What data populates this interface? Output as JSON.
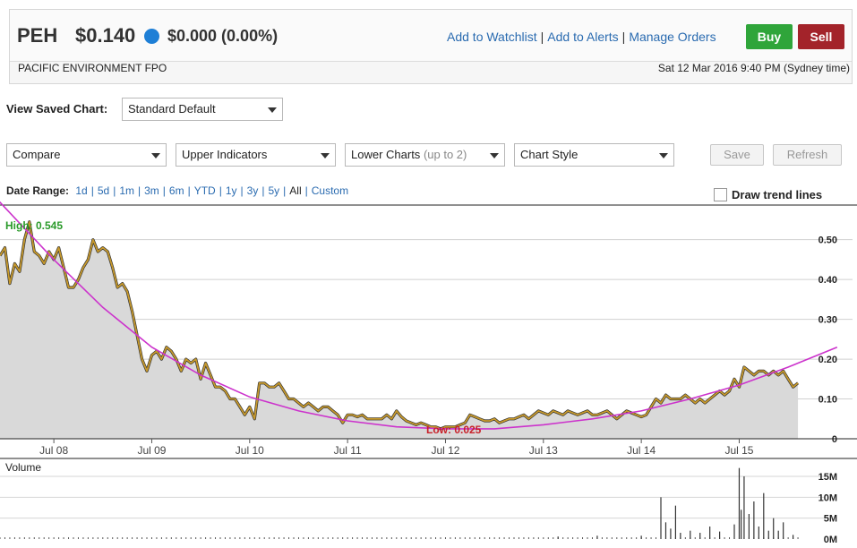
{
  "quote": {
    "ticker": "PEH",
    "price": "$0.140",
    "change": "$0.000 (0.00%)",
    "company": "PACIFIC ENVIRONMENT FPO",
    "datetime": "Sat 12 Mar 2016 9:40 PM (Sydney time)",
    "status_color": "#1e7fd6"
  },
  "actions": {
    "watchlist": "Add to Watchlist",
    "alerts": "Add to Alerts",
    "orders": "Manage Orders",
    "buy": "Buy",
    "sell": "Sell"
  },
  "controls": {
    "saved_label": "View Saved Chart:",
    "saved_value": "Standard Default",
    "compare": "Compare",
    "upper": "Upper Indicators",
    "lower": "Lower Charts",
    "lower_note": "(up to 2)",
    "style": "Chart Style",
    "save": "Save",
    "refresh": "Refresh",
    "date_range_label": "Date Range:",
    "ranges": [
      "1d",
      "5d",
      "1m",
      "3m",
      "6m",
      "YTD",
      "1y",
      "3y",
      "5y",
      "All",
      "Custom"
    ],
    "selected_range": "All",
    "trend_label": "Draw trend lines"
  },
  "chart_data": {
    "type": "line",
    "x_ticks": [
      "Jul 08",
      "Jul 09",
      "Jul 10",
      "Jul 11",
      "Jul 12",
      "Jul 13",
      "Jul 14",
      "Jul 15"
    ],
    "x_tick_dates": [
      2008.5,
      2009.5,
      2010.5,
      2011.5,
      2012.5,
      2013.5,
      2014.5,
      2015.5
    ],
    "x_range": [
      2007.95,
      2016.2
    ],
    "ylim": [
      0,
      0.56
    ],
    "y_ticks": [
      0,
      0.1,
      0.2,
      0.3,
      0.4,
      0.5
    ],
    "y_tick_labels": [
      "0",
      "0.10",
      "0.20",
      "0.30",
      "0.40",
      "0.50"
    ],
    "high_label": "High: 0.545",
    "low_label": "Low: 0.025",
    "price_series": [
      [
        2007.95,
        0.46
      ],
      [
        2008.0,
        0.48
      ],
      [
        2008.05,
        0.39
      ],
      [
        2008.1,
        0.44
      ],
      [
        2008.15,
        0.42
      ],
      [
        2008.2,
        0.5
      ],
      [
        2008.25,
        0.545
      ],
      [
        2008.3,
        0.47
      ],
      [
        2008.35,
        0.46
      ],
      [
        2008.4,
        0.44
      ],
      [
        2008.45,
        0.47
      ],
      [
        2008.5,
        0.45
      ],
      [
        2008.55,
        0.48
      ],
      [
        2008.6,
        0.43
      ],
      [
        2008.65,
        0.38
      ],
      [
        2008.7,
        0.38
      ],
      [
        2008.75,
        0.4
      ],
      [
        2008.8,
        0.43
      ],
      [
        2008.85,
        0.45
      ],
      [
        2008.9,
        0.5
      ],
      [
        2008.95,
        0.47
      ],
      [
        2009.0,
        0.48
      ],
      [
        2009.05,
        0.47
      ],
      [
        2009.1,
        0.43
      ],
      [
        2009.15,
        0.38
      ],
      [
        2009.2,
        0.39
      ],
      [
        2009.25,
        0.37
      ],
      [
        2009.3,
        0.32
      ],
      [
        2009.35,
        0.26
      ],
      [
        2009.4,
        0.2
      ],
      [
        2009.45,
        0.17
      ],
      [
        2009.5,
        0.21
      ],
      [
        2009.55,
        0.22
      ],
      [
        2009.6,
        0.2
      ],
      [
        2009.65,
        0.23
      ],
      [
        2009.7,
        0.22
      ],
      [
        2009.75,
        0.2
      ],
      [
        2009.8,
        0.17
      ],
      [
        2009.85,
        0.2
      ],
      [
        2009.9,
        0.19
      ],
      [
        2009.95,
        0.2
      ],
      [
        2010.0,
        0.15
      ],
      [
        2010.05,
        0.19
      ],
      [
        2010.1,
        0.16
      ],
      [
        2010.15,
        0.13
      ],
      [
        2010.2,
        0.13
      ],
      [
        2010.25,
        0.12
      ],
      [
        2010.3,
        0.1
      ],
      [
        2010.35,
        0.1
      ],
      [
        2010.4,
        0.08
      ],
      [
        2010.45,
        0.06
      ],
      [
        2010.5,
        0.08
      ],
      [
        2010.55,
        0.05
      ],
      [
        2010.6,
        0.14
      ],
      [
        2010.65,
        0.14
      ],
      [
        2010.7,
        0.13
      ],
      [
        2010.75,
        0.13
      ],
      [
        2010.8,
        0.14
      ],
      [
        2010.85,
        0.12
      ],
      [
        2010.9,
        0.1
      ],
      [
        2010.95,
        0.1
      ],
      [
        2011.0,
        0.09
      ],
      [
        2011.05,
        0.08
      ],
      [
        2011.1,
        0.09
      ],
      [
        2011.15,
        0.08
      ],
      [
        2011.2,
        0.07
      ],
      [
        2011.25,
        0.08
      ],
      [
        2011.3,
        0.08
      ],
      [
        2011.35,
        0.07
      ],
      [
        2011.4,
        0.06
      ],
      [
        2011.45,
        0.04
      ],
      [
        2011.5,
        0.06
      ],
      [
        2011.55,
        0.06
      ],
      [
        2011.6,
        0.055
      ],
      [
        2011.65,
        0.06
      ],
      [
        2011.7,
        0.05
      ],
      [
        2011.75,
        0.05
      ],
      [
        2011.8,
        0.05
      ],
      [
        2011.85,
        0.05
      ],
      [
        2011.9,
        0.06
      ],
      [
        2011.95,
        0.05
      ],
      [
        2012.0,
        0.07
      ],
      [
        2012.05,
        0.055
      ],
      [
        2012.1,
        0.045
      ],
      [
        2012.15,
        0.04
      ],
      [
        2012.2,
        0.035
      ],
      [
        2012.25,
        0.04
      ],
      [
        2012.3,
        0.035
      ],
      [
        2012.35,
        0.03
      ],
      [
        2012.4,
        0.03
      ],
      [
        2012.45,
        0.025
      ],
      [
        2012.5,
        0.03
      ],
      [
        2012.55,
        0.03
      ],
      [
        2012.6,
        0.03
      ],
      [
        2012.65,
        0.035
      ],
      [
        2012.7,
        0.04
      ],
      [
        2012.75,
        0.06
      ],
      [
        2012.8,
        0.055
      ],
      [
        2012.85,
        0.05
      ],
      [
        2012.9,
        0.045
      ],
      [
        2012.95,
        0.045
      ],
      [
        2013.0,
        0.05
      ],
      [
        2013.05,
        0.04
      ],
      [
        2013.1,
        0.045
      ],
      [
        2013.15,
        0.05
      ],
      [
        2013.2,
        0.05
      ],
      [
        2013.25,
        0.055
      ],
      [
        2013.3,
        0.06
      ],
      [
        2013.35,
        0.05
      ],
      [
        2013.4,
        0.06
      ],
      [
        2013.45,
        0.07
      ],
      [
        2013.5,
        0.065
      ],
      [
        2013.55,
        0.06
      ],
      [
        2013.6,
        0.07
      ],
      [
        2013.65,
        0.065
      ],
      [
        2013.7,
        0.06
      ],
      [
        2013.75,
        0.07
      ],
      [
        2013.8,
        0.065
      ],
      [
        2013.85,
        0.06
      ],
      [
        2013.9,
        0.065
      ],
      [
        2013.95,
        0.07
      ],
      [
        2014.0,
        0.06
      ],
      [
        2014.05,
        0.06
      ],
      [
        2014.1,
        0.065
      ],
      [
        2014.15,
        0.07
      ],
      [
        2014.2,
        0.06
      ],
      [
        2014.25,
        0.05
      ],
      [
        2014.3,
        0.06
      ],
      [
        2014.35,
        0.07
      ],
      [
        2014.4,
        0.065
      ],
      [
        2014.45,
        0.06
      ],
      [
        2014.5,
        0.055
      ],
      [
        2014.55,
        0.06
      ],
      [
        2014.6,
        0.08
      ],
      [
        2014.65,
        0.1
      ],
      [
        2014.7,
        0.09
      ],
      [
        2014.75,
        0.11
      ],
      [
        2014.8,
        0.1
      ],
      [
        2014.85,
        0.1
      ],
      [
        2014.9,
        0.1
      ],
      [
        2014.95,
        0.11
      ],
      [
        2015.0,
        0.1
      ],
      [
        2015.05,
        0.09
      ],
      [
        2015.1,
        0.1
      ],
      [
        2015.15,
        0.09
      ],
      [
        2015.2,
        0.1
      ],
      [
        2015.25,
        0.11
      ],
      [
        2015.3,
        0.12
      ],
      [
        2015.35,
        0.11
      ],
      [
        2015.4,
        0.12
      ],
      [
        2015.45,
        0.15
      ],
      [
        2015.5,
        0.13
      ],
      [
        2015.55,
        0.18
      ],
      [
        2015.6,
        0.17
      ],
      [
        2015.65,
        0.16
      ],
      [
        2015.7,
        0.17
      ],
      [
        2015.75,
        0.17
      ],
      [
        2015.8,
        0.16
      ],
      [
        2015.85,
        0.17
      ],
      [
        2015.9,
        0.16
      ],
      [
        2015.95,
        0.17
      ],
      [
        2016.0,
        0.15
      ],
      [
        2016.05,
        0.13
      ],
      [
        2016.1,
        0.14
      ]
    ],
    "trend_curve": [
      [
        2007.85,
        0.62
      ],
      [
        2008.5,
        0.45
      ],
      [
        2009.0,
        0.33
      ],
      [
        2009.5,
        0.23
      ],
      [
        2010.0,
        0.16
      ],
      [
        2010.5,
        0.105
      ],
      [
        2011.0,
        0.07
      ],
      [
        2011.5,
        0.045
      ],
      [
        2012.0,
        0.03
      ],
      [
        2012.5,
        0.025
      ],
      [
        2013.0,
        0.025
      ],
      [
        2013.5,
        0.035
      ],
      [
        2014.0,
        0.05
      ],
      [
        2014.5,
        0.07
      ],
      [
        2015.0,
        0.1
      ],
      [
        2015.5,
        0.135
      ],
      [
        2016.0,
        0.18
      ],
      [
        2016.5,
        0.23
      ]
    ],
    "volume_label": "Volume",
    "volume_ylim": [
      0,
      18
    ],
    "volume_ticks": [
      0,
      5,
      10,
      15
    ],
    "volume_tick_labels": [
      "0M",
      "5M",
      "10M",
      "15M"
    ],
    "volume_spikes": [
      [
        2013.65,
        0.6
      ],
      [
        2014.05,
        0.8
      ],
      [
        2014.5,
        0.8
      ],
      [
        2014.7,
        10
      ],
      [
        2014.75,
        4
      ],
      [
        2014.8,
        2.5
      ],
      [
        2014.85,
        8
      ],
      [
        2014.9,
        1.5
      ],
      [
        2015.0,
        2
      ],
      [
        2015.1,
        1.5
      ],
      [
        2015.2,
        3
      ],
      [
        2015.3,
        1.8
      ],
      [
        2015.45,
        3.5
      ],
      [
        2015.5,
        17
      ],
      [
        2015.52,
        7
      ],
      [
        2015.55,
        15
      ],
      [
        2015.6,
        6
      ],
      [
        2015.65,
        9
      ],
      [
        2015.7,
        3
      ],
      [
        2015.75,
        11
      ],
      [
        2015.8,
        2
      ],
      [
        2015.85,
        5
      ],
      [
        2015.9,
        2
      ],
      [
        2015.95,
        4
      ],
      [
        2016.05,
        1
      ]
    ],
    "colors": {
      "line": "#c89a2c",
      "area": "#d9d9d9",
      "trend": "#cc33cc",
      "high": "#2a9a2a",
      "low": "#c8222a"
    }
  }
}
